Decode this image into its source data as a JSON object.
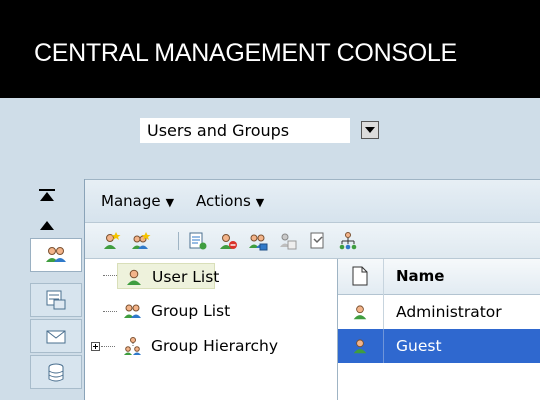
{
  "header": {
    "title": "CENTRAL MANAGEMENT CONSOLE"
  },
  "nav_select": {
    "value": "Users and Groups"
  },
  "menubar": {
    "manage_label": "Manage",
    "actions_label": "Actions"
  },
  "toolbar": {
    "icons": [
      "new-user-icon",
      "new-group-icon",
      "properties-icon",
      "remove-user-icon",
      "account-manager-icon",
      "copy-icon",
      "import-icon",
      "hierarchy-icon"
    ]
  },
  "tree": {
    "items": [
      {
        "label": "User List"
      },
      {
        "label": "Group List"
      },
      {
        "label": "Group Hierarchy"
      }
    ]
  },
  "grid": {
    "column_name": "Name",
    "rows": [
      {
        "name": "Administrator"
      },
      {
        "name": "Guest"
      }
    ]
  },
  "colors": {
    "header_bg": "#000000",
    "selection_blue": "#2f68cf",
    "tree_selection": "#eef2dc",
    "background": "#cfdde8"
  }
}
